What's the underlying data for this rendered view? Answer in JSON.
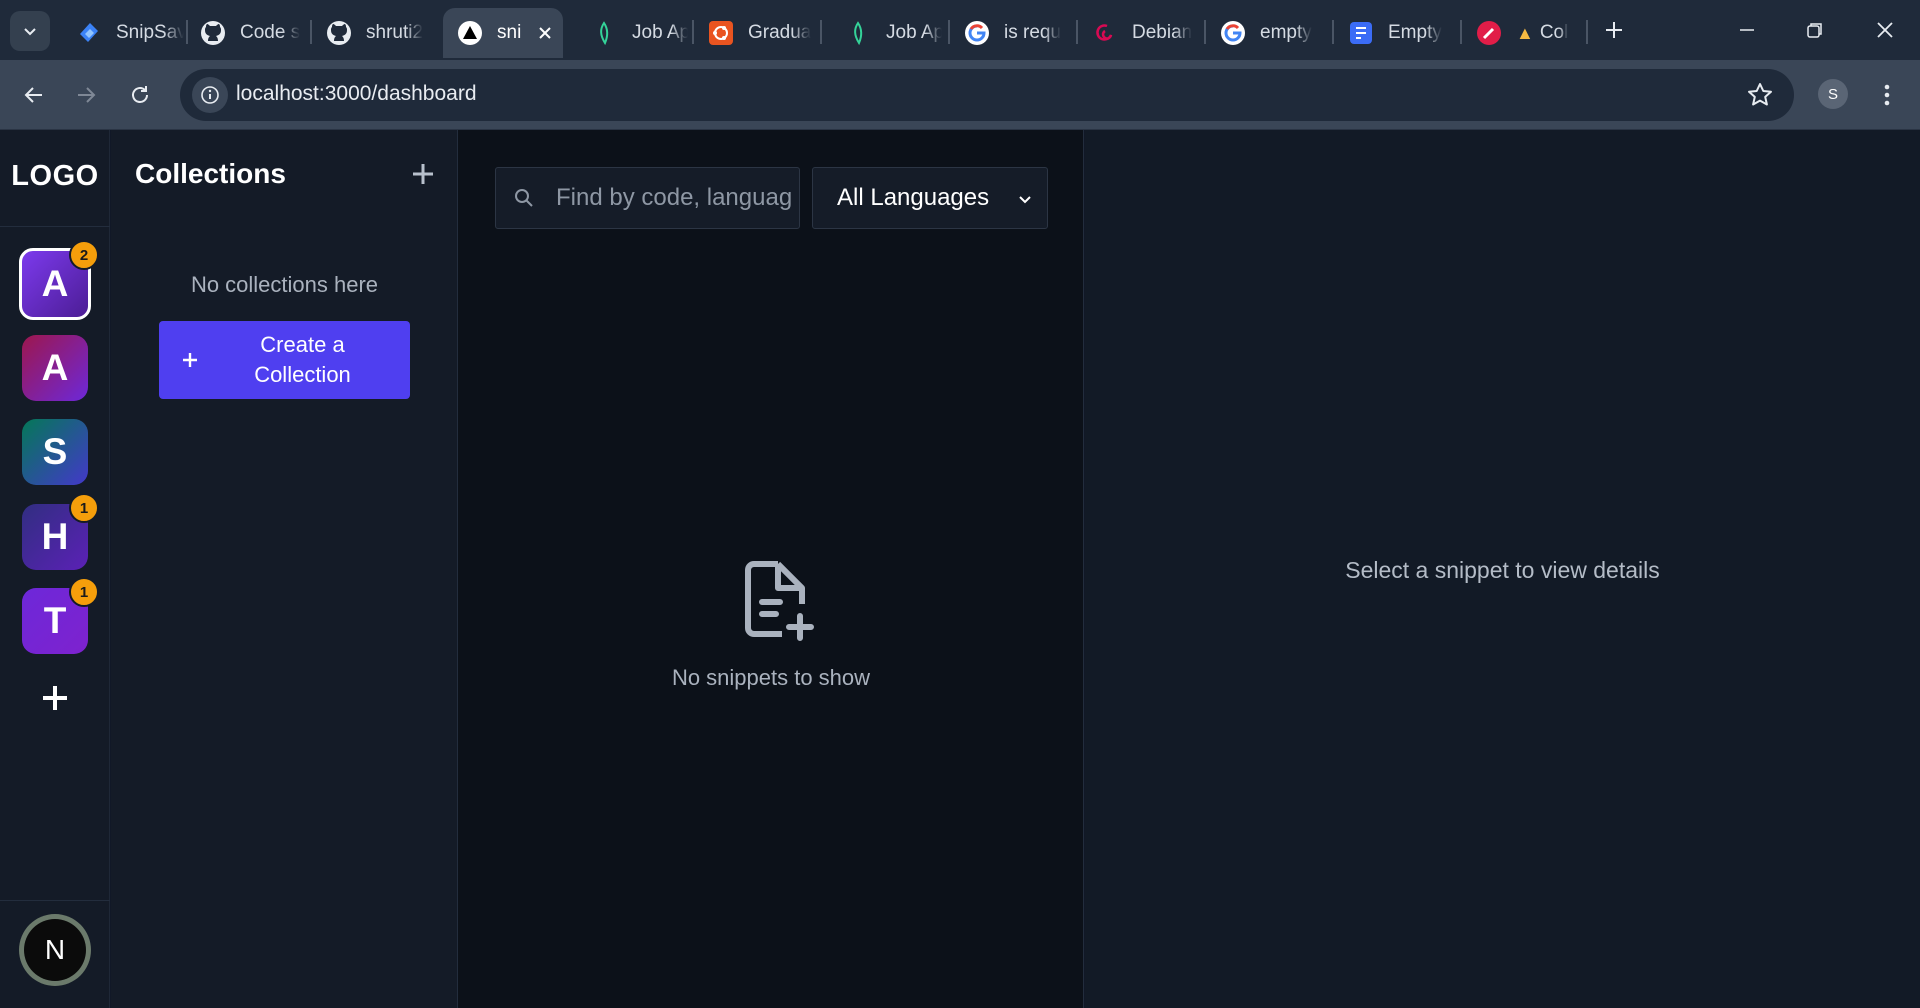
{
  "browser": {
    "tabs": [
      {
        "label": "SnipSav",
        "icon": "snipsave-icon"
      },
      {
        "label": "Code s",
        "icon": "github-icon"
      },
      {
        "label": "shruti2",
        "icon": "github-icon"
      },
      {
        "label": "sni",
        "icon": "nextjs-triangle-icon",
        "active": true
      },
      {
        "label": "Job Ap",
        "icon": "green-leaf-icon"
      },
      {
        "label": "Gradua",
        "icon": "ubuntu-icon"
      },
      {
        "label": "Job Ap",
        "icon": "green-leaf-icon"
      },
      {
        "label": "is requ",
        "icon": "google-icon"
      },
      {
        "label": "Debian",
        "icon": "debian-icon"
      },
      {
        "label": "empty",
        "icon": "google-icon"
      },
      {
        "label": "Empty",
        "icon": "forms-icon"
      },
      {
        "label": "Col",
        "icon": "red-pencil-icon"
      }
    ],
    "url": "localhost:3000/dashboard",
    "profile_initial": "S"
  },
  "rail": {
    "logo": "LOGO",
    "workspaces": [
      {
        "letter": "A",
        "badge": "2",
        "active": true
      },
      {
        "letter": "A",
        "badge": null
      },
      {
        "letter": "S",
        "badge": null
      },
      {
        "letter": "H",
        "badge": "1"
      },
      {
        "letter": "T",
        "badge": "1"
      }
    ],
    "user_initial": "N"
  },
  "collections": {
    "title": "Collections",
    "empty_text": "No collections here",
    "create_label_line1": "Create a",
    "create_label_line2": "Collection"
  },
  "snippets": {
    "search_placeholder": "Find by code, language",
    "language_select": "All Languages",
    "empty_text": "No snippets to show"
  },
  "detail": {
    "empty_text": "Select a snippet to view details"
  },
  "colors": {
    "accent": "#4f3ff0",
    "badge": "#f59e0b"
  }
}
